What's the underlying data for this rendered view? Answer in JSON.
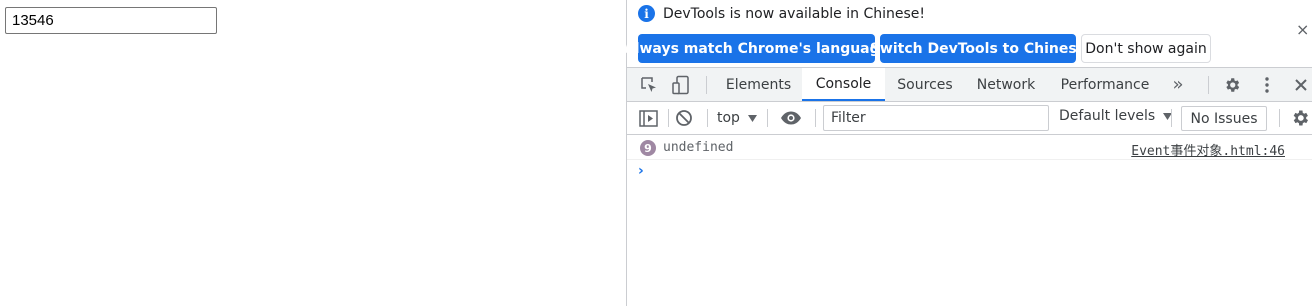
{
  "page": {
    "input_value": "13546"
  },
  "infobar": {
    "message": "DevTools is now available in Chinese!",
    "buttons": {
      "match": "Always match Chrome's language",
      "switch": "Switch DevTools to Chinese",
      "dont_show": "Don't show again"
    },
    "close": "×"
  },
  "tabs": [
    {
      "label": "Elements"
    },
    {
      "label": "Console",
      "active": true
    },
    {
      "label": "Sources"
    },
    {
      "label": "Network"
    },
    {
      "label": "Performance"
    }
  ],
  "more_tabs": "»",
  "console_toolbar": {
    "context": "top",
    "filter_placeholder": "Filter",
    "levels": "Default levels",
    "issues": "No Issues"
  },
  "console": {
    "messages": [
      {
        "repeat_count": "9",
        "text": "undefined",
        "source": "Event事件对象.html:46"
      }
    ],
    "prompt": "›"
  },
  "colors": {
    "accent": "#1a73e8",
    "toolbar_bg": "#f1f3f4",
    "badge": "#9f88a3"
  }
}
